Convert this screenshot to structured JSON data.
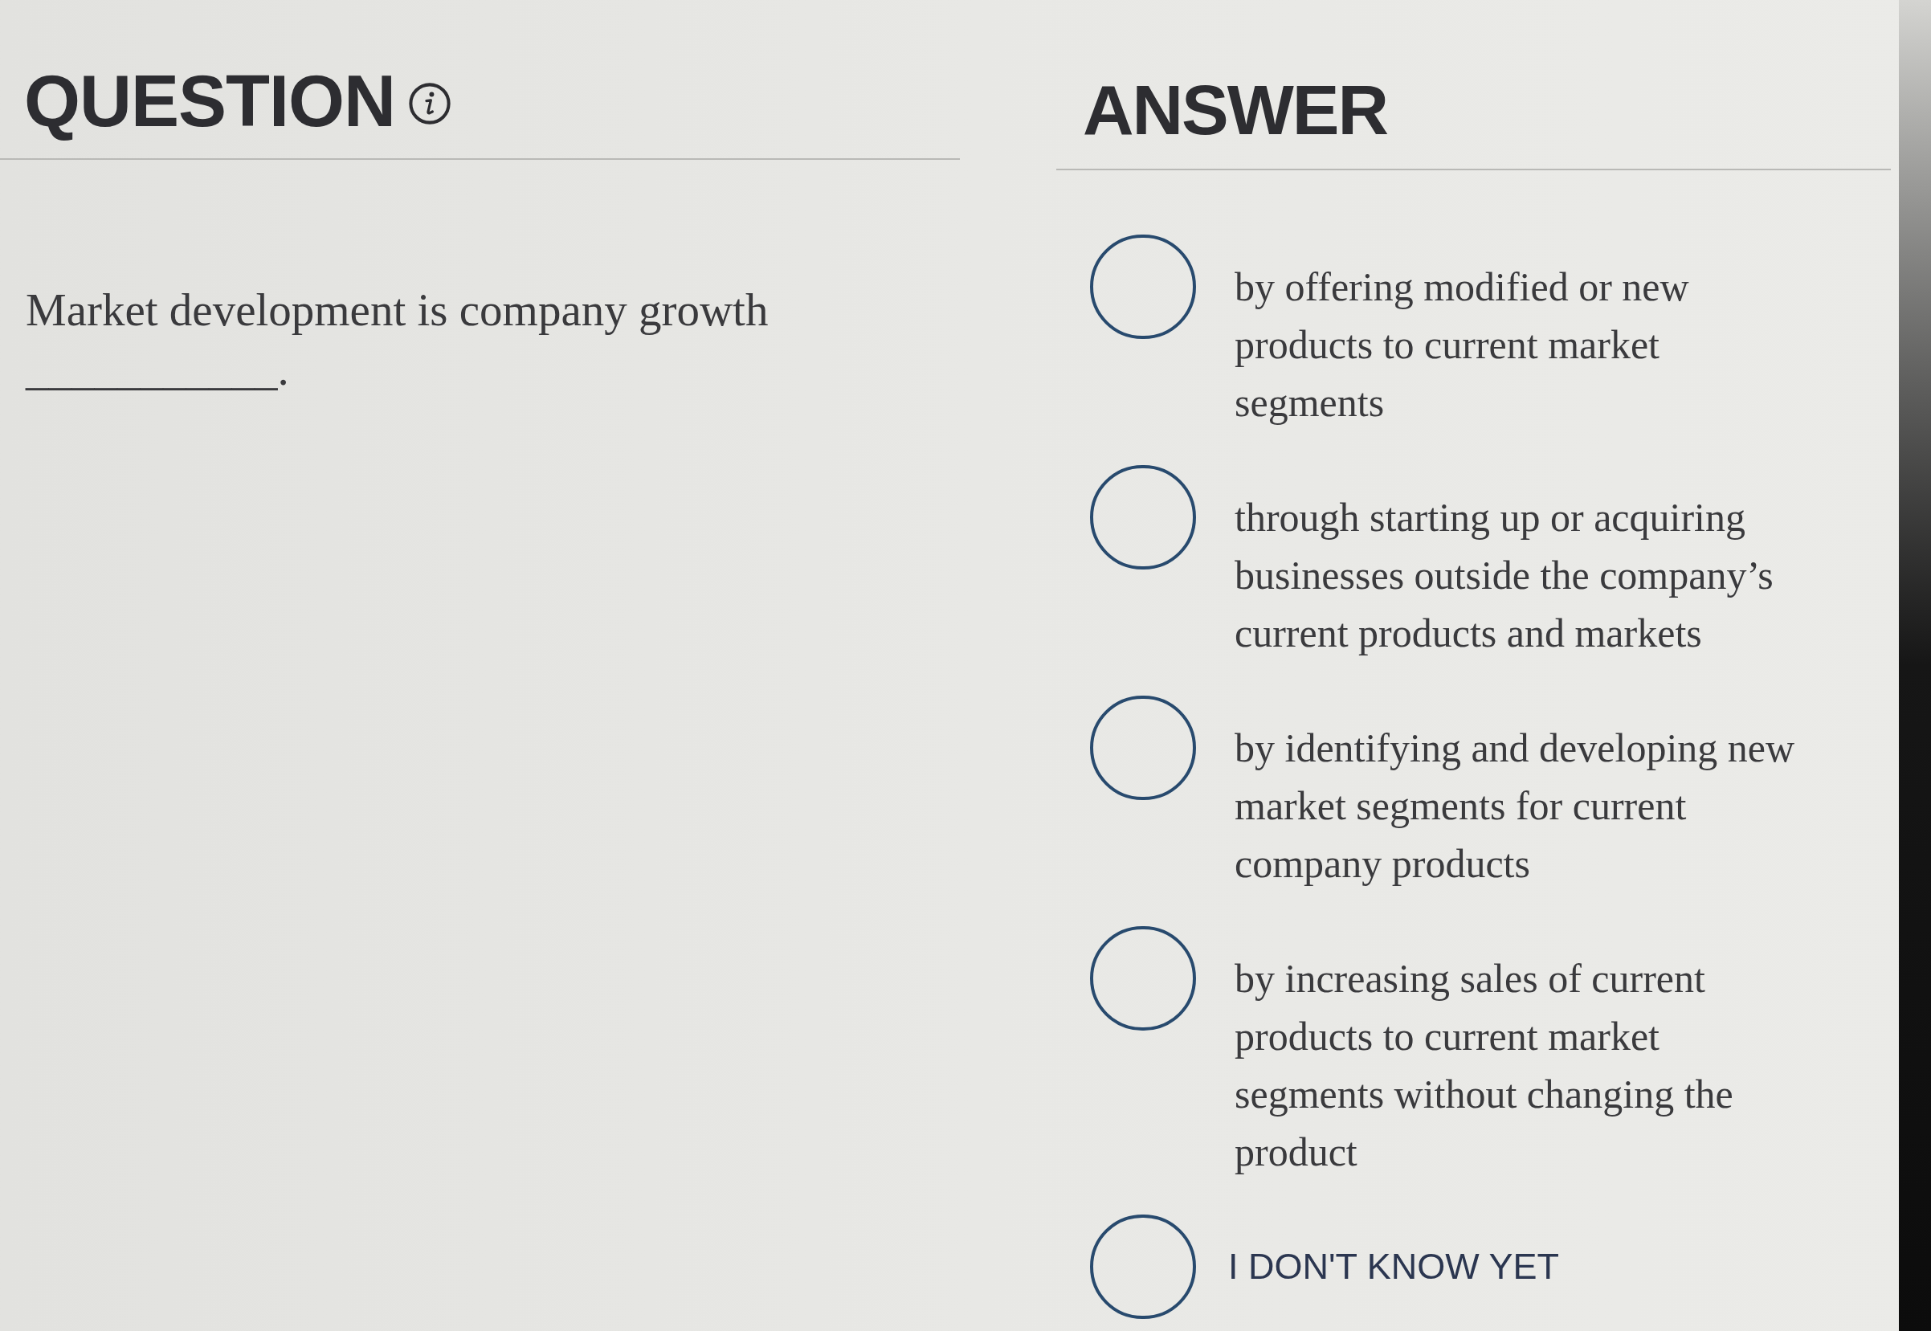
{
  "question": {
    "heading": "QUESTION",
    "text": "Market development is company growth ___________."
  },
  "answer": {
    "heading": "ANSWER",
    "options": [
      {
        "kind": "choice",
        "label": "by offering modified or new products to current market segments",
        "selected": false
      },
      {
        "kind": "choice",
        "label": "through starting up or acquiring businesses outside the company’s current products and markets",
        "selected": false
      },
      {
        "kind": "choice",
        "label": "by identifying and developing new market segments for current company products",
        "selected": false
      },
      {
        "kind": "choice",
        "label": "by increasing sales of current products to current market segments without changing the product",
        "selected": false
      },
      {
        "kind": "idk",
        "label": "I DON'T KNOW YET",
        "selected": false
      }
    ]
  }
}
